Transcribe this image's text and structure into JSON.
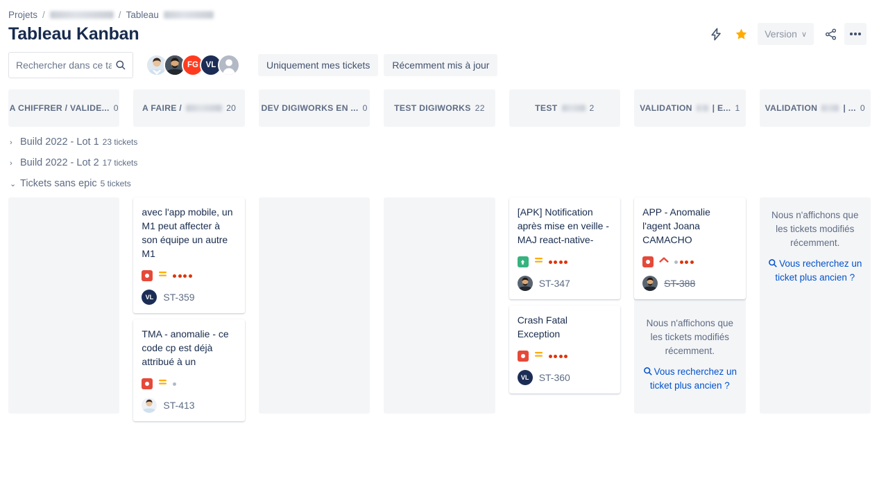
{
  "breadcrumb": {
    "root": "Projets",
    "separator": "/",
    "project_redacted": true,
    "board": "Tableau",
    "board_redacted": true
  },
  "header": {
    "title": "Tableau Kanban",
    "actions": {
      "lightning_icon": "lightning-bolt-icon",
      "star_icon": "star-icon",
      "star_color": "#ffab00",
      "version_label": "Version",
      "version_caret": "∨",
      "share_icon": "share-icon",
      "more_icon": "more-options-icon"
    }
  },
  "toolbar": {
    "search": {
      "placeholder": "Rechercher dans ce tab",
      "value": "",
      "icon": "search-icon"
    },
    "avatars": [
      {
        "name": "avatar-photo-1",
        "type": "photo",
        "skin": "#e8c39e",
        "shirt": "#cfe0f0",
        "hair": "#3b2a20"
      },
      {
        "name": "avatar-photo-2",
        "type": "photo",
        "skin": "#d9a878",
        "shirt": "#2f3640",
        "hair": "#231812"
      },
      {
        "name": "avatar-fg",
        "type": "initials",
        "initials": "FG",
        "color": "#ff3b1f"
      },
      {
        "name": "avatar-vl",
        "type": "initials",
        "initials": "VL",
        "color": "#1c2d55"
      },
      {
        "name": "avatar-generic",
        "type": "generic",
        "color": "#9aa5b1"
      }
    ],
    "filters": [
      {
        "label": "Uniquement mes tickets"
      },
      {
        "label": "Récemment mis à jour"
      }
    ]
  },
  "columns": [
    {
      "label": "A CHIFFRER / VALIDE...",
      "count": "0",
      "redacted": false
    },
    {
      "label": "A FAIRE /",
      "count": "20",
      "redacted": true,
      "redact_width": 52
    },
    {
      "label": "DEV DIGIWORKS EN ...",
      "count": "0",
      "redacted": false
    },
    {
      "label": "TEST DIGIWORKS",
      "count": "22",
      "redacted": false
    },
    {
      "label": "TEST",
      "count": "2",
      "redacted": true,
      "redact_width": 34,
      "suffix": ""
    },
    {
      "label": "VALIDATION",
      "count": "1",
      "redacted": true,
      "redact_width": 34,
      "suffix": "| E..."
    },
    {
      "label": "VALIDATION",
      "count": "0",
      "redacted": true,
      "redact_width": 34,
      "suffix": "| ..."
    }
  ],
  "swimlanes": [
    {
      "name": "Build 2022 - Lot 1",
      "count": "23 tickets",
      "expanded": false,
      "chevron": "›"
    },
    {
      "name": "Build 2022 - Lot 2",
      "count": "17 tickets",
      "expanded": false,
      "chevron": "›"
    },
    {
      "name": "Tickets sans epic",
      "count": "5 tickets",
      "expanded": true,
      "chevron": "⌄"
    }
  ],
  "empty_message": {
    "text": "Nous n'affichons que les tickets modifiés récemment.",
    "link": "Vous recherchez un ticket plus ancien ?",
    "link_icon": "search-icon",
    "link_color": "#0052cc"
  },
  "cards": {
    "c1": {
      "title": "avec l'app mobile, un M1 peut affecter à son équipe un autre M1",
      "type": "bug",
      "type_color": "#e5493a",
      "priority": "medium",
      "priority_color": "#ffab00",
      "dots": [
        "#de350b",
        "#de350b",
        "#de350b",
        "#de350b"
      ],
      "assignee": {
        "type": "initials",
        "initials": "VL",
        "color": "#1c2d55"
      },
      "key": "ST-359",
      "done": false
    },
    "c2": {
      "title": "TMA - anomalie - ce code cp est déjà attribué à un",
      "type": "bug",
      "type_color": "#e5493a",
      "priority": "medium",
      "priority_color": "#ffab00",
      "dots": [
        "#b3bac5"
      ],
      "assignee": {
        "type": "photo",
        "skin": "#e8c39e",
        "shirt": "#cfe0f0",
        "hair": "#3b2a20"
      },
      "key": "ST-413",
      "done": false
    },
    "c3": {
      "title": "[APK] Notification après mise en veille - MAJ react-native-",
      "type": "story",
      "type_color": "#36b37e",
      "priority": "medium",
      "priority_color": "#ffab00",
      "dots": [
        "#de350b",
        "#de350b",
        "#de350b",
        "#de350b"
      ],
      "assignee": {
        "type": "photo",
        "skin": "#d9a878",
        "shirt": "#2f3640",
        "hair": "#231812"
      },
      "key": "ST-347",
      "done": false
    },
    "c4": {
      "title": "Crash Fatal Exception",
      "type": "bug",
      "type_color": "#e5493a",
      "priority": "medium",
      "priority_color": "#ffab00",
      "dots": [
        "#de350b",
        "#de350b",
        "#de350b",
        "#de350b"
      ],
      "assignee": {
        "type": "initials",
        "initials": "VL",
        "color": "#1c2d55"
      },
      "key": "ST-360",
      "done": false
    },
    "c5": {
      "title": "APP - Anomalie l'agent Joana CAMACHO",
      "type": "bug",
      "type_color": "#e5493a",
      "priority": "high",
      "priority_color": "#e5493a",
      "dots": [
        "#b3bac5",
        "#de350b",
        "#de350b",
        "#de350b"
      ],
      "assignee": {
        "type": "photo",
        "skin": "#d9a878",
        "shirt": "#2f3640",
        "hair": "#231812"
      },
      "key": "ST-388",
      "done": true
    }
  }
}
